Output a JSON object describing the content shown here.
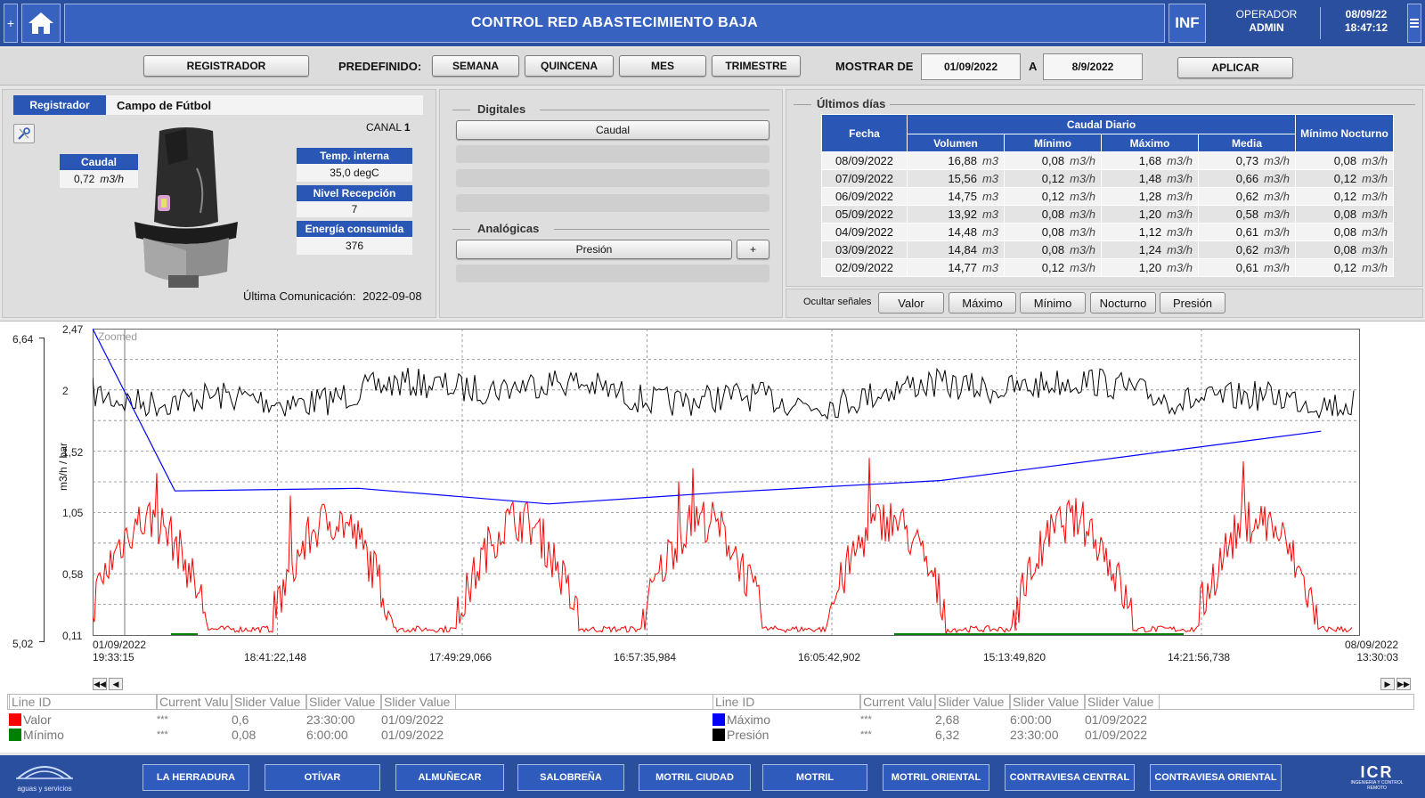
{
  "header": {
    "plus_left": "+",
    "title": "CONTROL RED ABASTECIMIENTO BAJA",
    "inf_label": "INF",
    "role": "OPERADOR",
    "user": "ADMIN",
    "date": "08/09/22",
    "time": "18:47:12",
    "menu_icon": "menu-icon"
  },
  "filter": {
    "registrador_btn": "REGISTRADOR",
    "predefinido_label": "PREDEFINIDO:",
    "presets": [
      "SEMANA",
      "QUINCENA",
      "MES",
      "TRIMESTRE"
    ],
    "mostrar_label": "MOSTRAR DE",
    "from_date": "01/09/2022",
    "a_label": "A",
    "to_date": "8/9/2022",
    "apply_btn": "APLICAR"
  },
  "device": {
    "tab_label": "Registrador",
    "name": "Campo de Fútbol",
    "canal_label": "CANAL",
    "canal_value": "1",
    "caudal_label": "Caudal",
    "caudal_value": "0,72",
    "caudal_unit": "m3/h",
    "temp_label": "Temp. interna",
    "temp_value": "35,0 degC",
    "nivel_label": "Nivel Recepción",
    "nivel_value": "7",
    "energia_label": "Energía consumida",
    "energia_value": "376",
    "last_comm_label": "Última Comunicación:",
    "last_comm_value": "2022-09-08"
  },
  "signals": {
    "digitales_title": "Digitales",
    "digital_btn": "Caudal",
    "analogicas_title": "Analógicas",
    "analog_btn": "Presión",
    "analog_plus": "+"
  },
  "history": {
    "title": "Últimos días",
    "headers": {
      "fecha": "Fecha",
      "caudal_diario": "Caudal Diario",
      "volumen": "Volumen",
      "minimo": "Mínimo",
      "maximo": "Máximo",
      "media": "Media",
      "minimo_nocturno": "Mínimo Nocturno"
    },
    "rows": [
      {
        "fecha": "08/09/2022",
        "vol": "16,88",
        "vol_u": "m3",
        "min": "0,08",
        "max": "1,68",
        "media": "0,73",
        "noct": "0,08",
        "u": "m3/h"
      },
      {
        "fecha": "07/09/2022",
        "vol": "15,56",
        "vol_u": "m3",
        "min": "0,12",
        "max": "1,48",
        "media": "0,66",
        "noct": "0,12",
        "u": "m3/h"
      },
      {
        "fecha": "06/09/2022",
        "vol": "14,75",
        "vol_u": "m3",
        "min": "0,12",
        "max": "1,28",
        "media": "0,62",
        "noct": "0,12",
        "u": "m3/h"
      },
      {
        "fecha": "05/09/2022",
        "vol": "13,92",
        "vol_u": "m3",
        "min": "0,08",
        "max": "1,20",
        "media": "0,58",
        "noct": "0,08",
        "u": "m3/h"
      },
      {
        "fecha": "04/09/2022",
        "vol": "14,48",
        "vol_u": "m3",
        "min": "0,08",
        "max": "1,12",
        "media": "0,61",
        "noct": "0,08",
        "u": "m3/h"
      },
      {
        "fecha": "03/09/2022",
        "vol": "14,84",
        "vol_u": "m3",
        "min": "0,08",
        "max": "1,24",
        "media": "0,62",
        "noct": "0,08",
        "u": "m3/h"
      },
      {
        "fecha": "02/09/2022",
        "vol": "14,77",
        "vol_u": "m3",
        "min": "0,12",
        "max": "1,20",
        "media": "0,61",
        "noct": "0,12",
        "u": "m3/h"
      }
    ],
    "hide_label": "Ocultar señales",
    "hide_buttons": [
      "Valor",
      "Máximo",
      "Mínimo",
      "Nocturno",
      "Presión"
    ]
  },
  "chart_data": {
    "type": "line",
    "zoom_label": "Zoomed",
    "ylabel": "m3/h / bar",
    "y_ticks": [
      "2,47",
      "2",
      "1,52",
      "1,05",
      "0,58",
      "0,11"
    ],
    "ylim": [
      0.11,
      2.47
    ],
    "secondary_y_ticks": [
      "6,64",
      "5,02"
    ],
    "secondary_ylim": [
      5.02,
      6.64
    ],
    "x_ticks": [
      "01/09/2022\n19:33:15",
      "18:41:22,148",
      "17:49:29,066",
      "16:57:35,984",
      "16:05:42,902",
      "15:13:49,820",
      "14:21:56,738",
      "08/09/2022\n13:30:03"
    ],
    "x_start": "01/09/2022 19:33:15",
    "x_end": "08/09/2022 13:30:03",
    "series": [
      {
        "name": "Valor",
        "color": "#ff0000",
        "pattern": "diurnal",
        "range": [
          0.11,
          1.68
        ]
      },
      {
        "name": "Mínimo",
        "color": "#008000",
        "values": [
          0.11,
          0.11
        ]
      },
      {
        "name": "Máximo",
        "color": "#0000ff",
        "x": [
          0,
          0.065,
          0.21,
          0.36,
          0.5,
          0.67,
          0.97
        ],
        "values": [
          2.47,
          1.22,
          1.24,
          1.12,
          1.21,
          1.3,
          1.68
        ]
      },
      {
        "name": "Presión",
        "color": "#000000",
        "pattern": "noise",
        "range": [
          5.9,
          6.2
        ]
      }
    ]
  },
  "legend": {
    "headers": [
      "Line ID",
      "Current Valu",
      "Slider Value",
      "Slider Value",
      "Slider Value"
    ],
    "left": [
      {
        "name": "Valor",
        "color": "#ff0000",
        "cur": "***",
        "s1": "0,6",
        "s2": "23:30:00",
        "s3": "01/09/2022"
      },
      {
        "name": "Mínimo",
        "color": "#008000",
        "cur": "***",
        "s1": "0,08",
        "s2": "6:00:00",
        "s3": "01/09/2022"
      }
    ],
    "right": [
      {
        "name": "Máximo",
        "color": "#0000ff",
        "cur": "***",
        "s1": "2,68",
        "s2": "6:00:00",
        "s3": "01/09/2022"
      },
      {
        "name": "Presión",
        "color": "#000000",
        "cur": "***",
        "s1": "6,32",
        "s2": "23:30:00",
        "s3": "01/09/2022"
      }
    ]
  },
  "nav": {
    "logo_text": "aguas y servicios",
    "items": [
      "LA HERRADURA",
      "OTÍVAR",
      "ALMUÑECAR",
      "SALOBREÑA",
      "MOTRIL CIUDAD",
      "MOTRIL",
      "MOTRIL ORIENTAL",
      "CONTRAVIESA CENTRAL",
      "CONTRAVIESA ORIENTAL"
    ],
    "brand": "ICR",
    "brand_sub": "INGENIERIA Y CONTROL REMOTO"
  }
}
